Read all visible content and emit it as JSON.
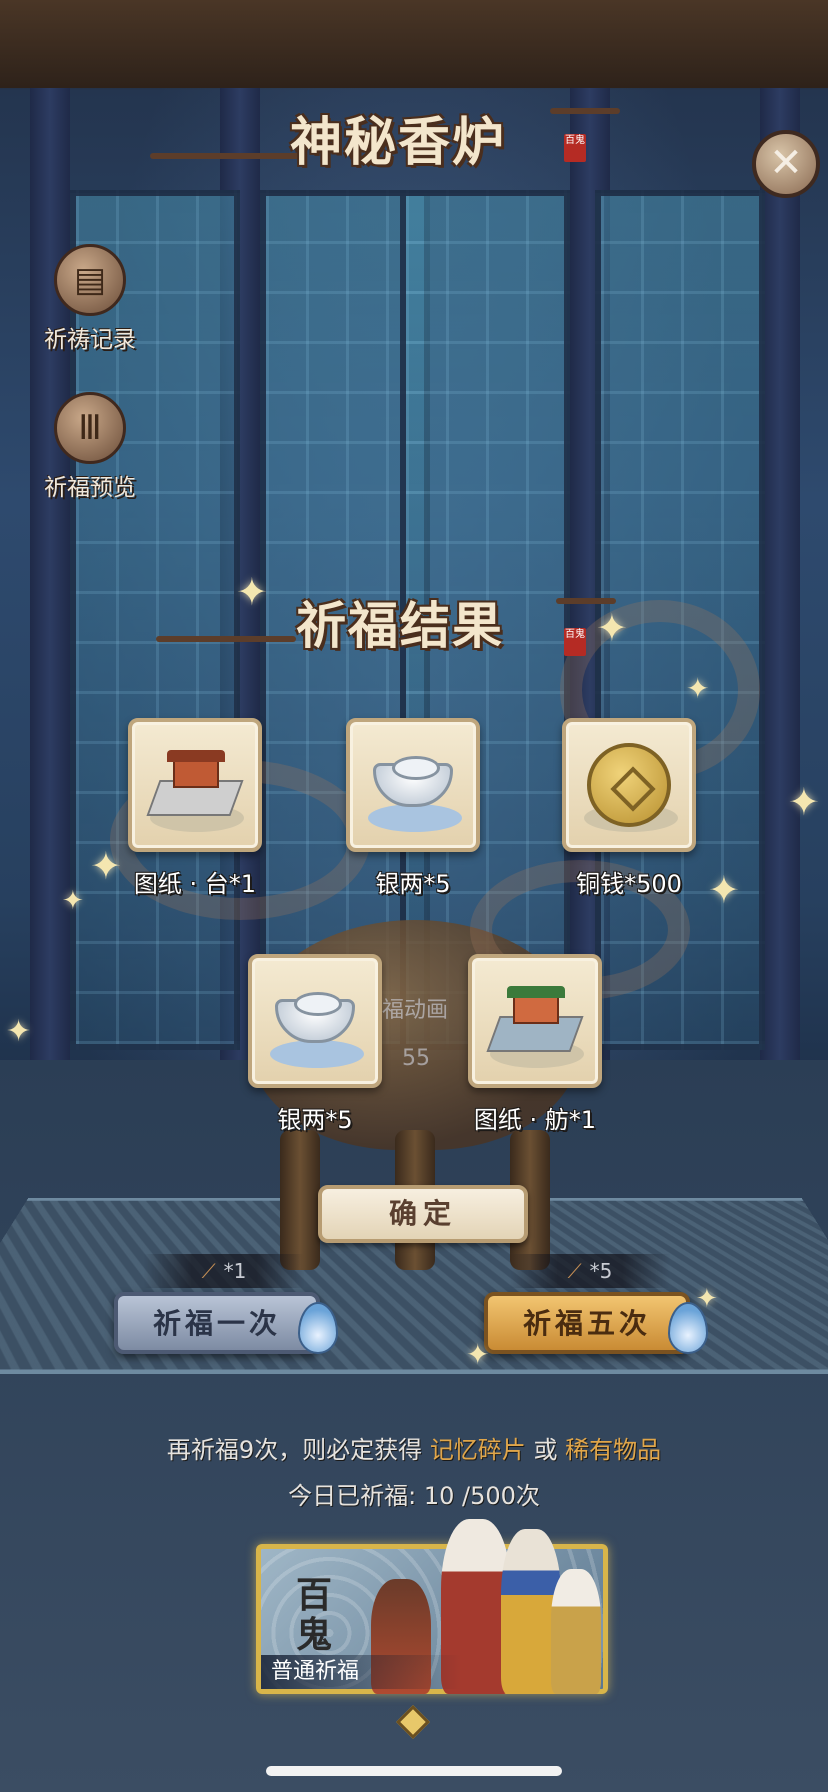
{
  "header": {
    "title": "神秘香炉",
    "seal": "百鬼",
    "close_label": "✕"
  },
  "side_menu": [
    {
      "label": "祈祷记录",
      "icon": "scroll-icon"
    },
    {
      "label": "祈福预览",
      "icon": "incense-sticks-icon"
    }
  ],
  "result": {
    "title": "祈福结果",
    "seal": "百鬼",
    "items": [
      {
        "label": "图纸 · 台*1",
        "icon": "blueprint-terrace-icon"
      },
      {
        "label": "银两*5",
        "icon": "silver-ingot-icon"
      },
      {
        "label": "铜钱*500",
        "icon": "copper-coin-icon"
      },
      {
        "label": "银两*5",
        "icon": "silver-ingot-icon"
      },
      {
        "label": "图纸 · 舫*1",
        "icon": "blueprint-boat-icon"
      }
    ],
    "confirm_label": "确定"
  },
  "background_text": {
    "anim_label": "福动画",
    "number": "55"
  },
  "pray": {
    "once": {
      "label": "祈福一次",
      "cost": "*1"
    },
    "five": {
      "label": "祈福五次",
      "cost": "*5"
    }
  },
  "notice": {
    "prefix": "再祈福9次，则必定获得",
    "item1": "记忆碎片",
    "joiner": "或",
    "item2": "稀有物品",
    "today": "今日已祈福: 10 /500次"
  },
  "banner": {
    "logo_line1": "百",
    "logo_line2": "鬼",
    "label": "普通祈福"
  },
  "colors": {
    "highlight": "#e0a64a",
    "banner_border": "#d8b54a"
  }
}
